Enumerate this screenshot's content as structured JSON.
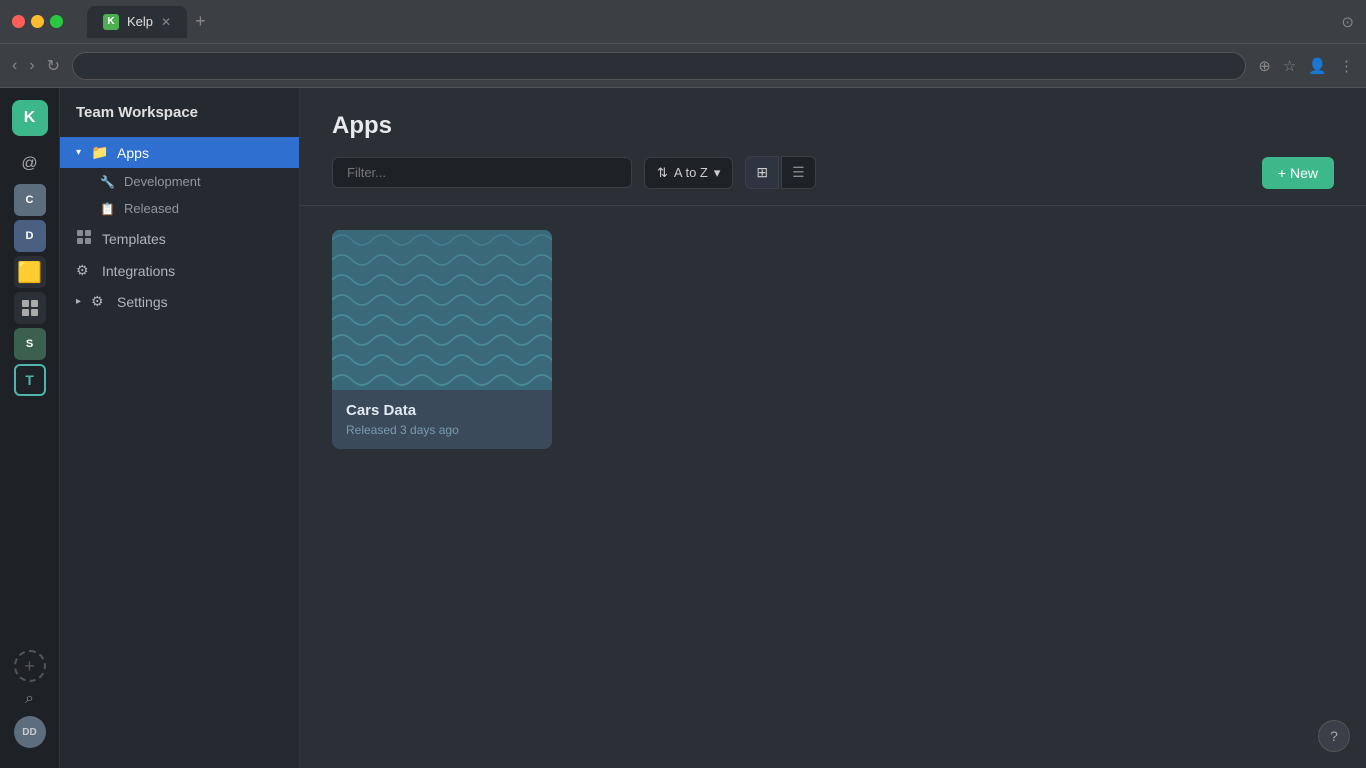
{
  "browser": {
    "tab_title": "Kelp",
    "tab_favicon": "K",
    "address": ""
  },
  "workspace": {
    "title": "Team Workspace",
    "logo_text": "K",
    "logo_bg": "#3db88a"
  },
  "sidebar": {
    "apps_label": "Apps",
    "apps_chevron": "▾",
    "sub_items": [
      {
        "label": "Development",
        "icon": "🔧"
      },
      {
        "label": "Released",
        "icon": "📋"
      }
    ],
    "templates_label": "Templates",
    "integrations_label": "Integrations",
    "settings_label": "Settings"
  },
  "icon_sidebar": {
    "workspaces": [
      {
        "label": "@",
        "bg": "#2b2f36"
      },
      {
        "label": "C",
        "bg": "#2b2f36"
      },
      {
        "label": "D",
        "bg": "#2b2f36"
      },
      {
        "label": "🟡",
        "bg": "#2b2f36"
      },
      {
        "label": "⊞",
        "bg": "#2b2f36"
      },
      {
        "label": "S",
        "bg": "#2b2f36"
      },
      {
        "label": "T",
        "active": true
      }
    ]
  },
  "main": {
    "page_title": "Apps",
    "filter_placeholder": "Filter...",
    "sort_label": "A to Z",
    "new_button": "+ New",
    "apps": [
      {
        "name": "Cars Data",
        "meta": "Released 3 days ago"
      }
    ]
  },
  "user": {
    "initials": "DD"
  }
}
